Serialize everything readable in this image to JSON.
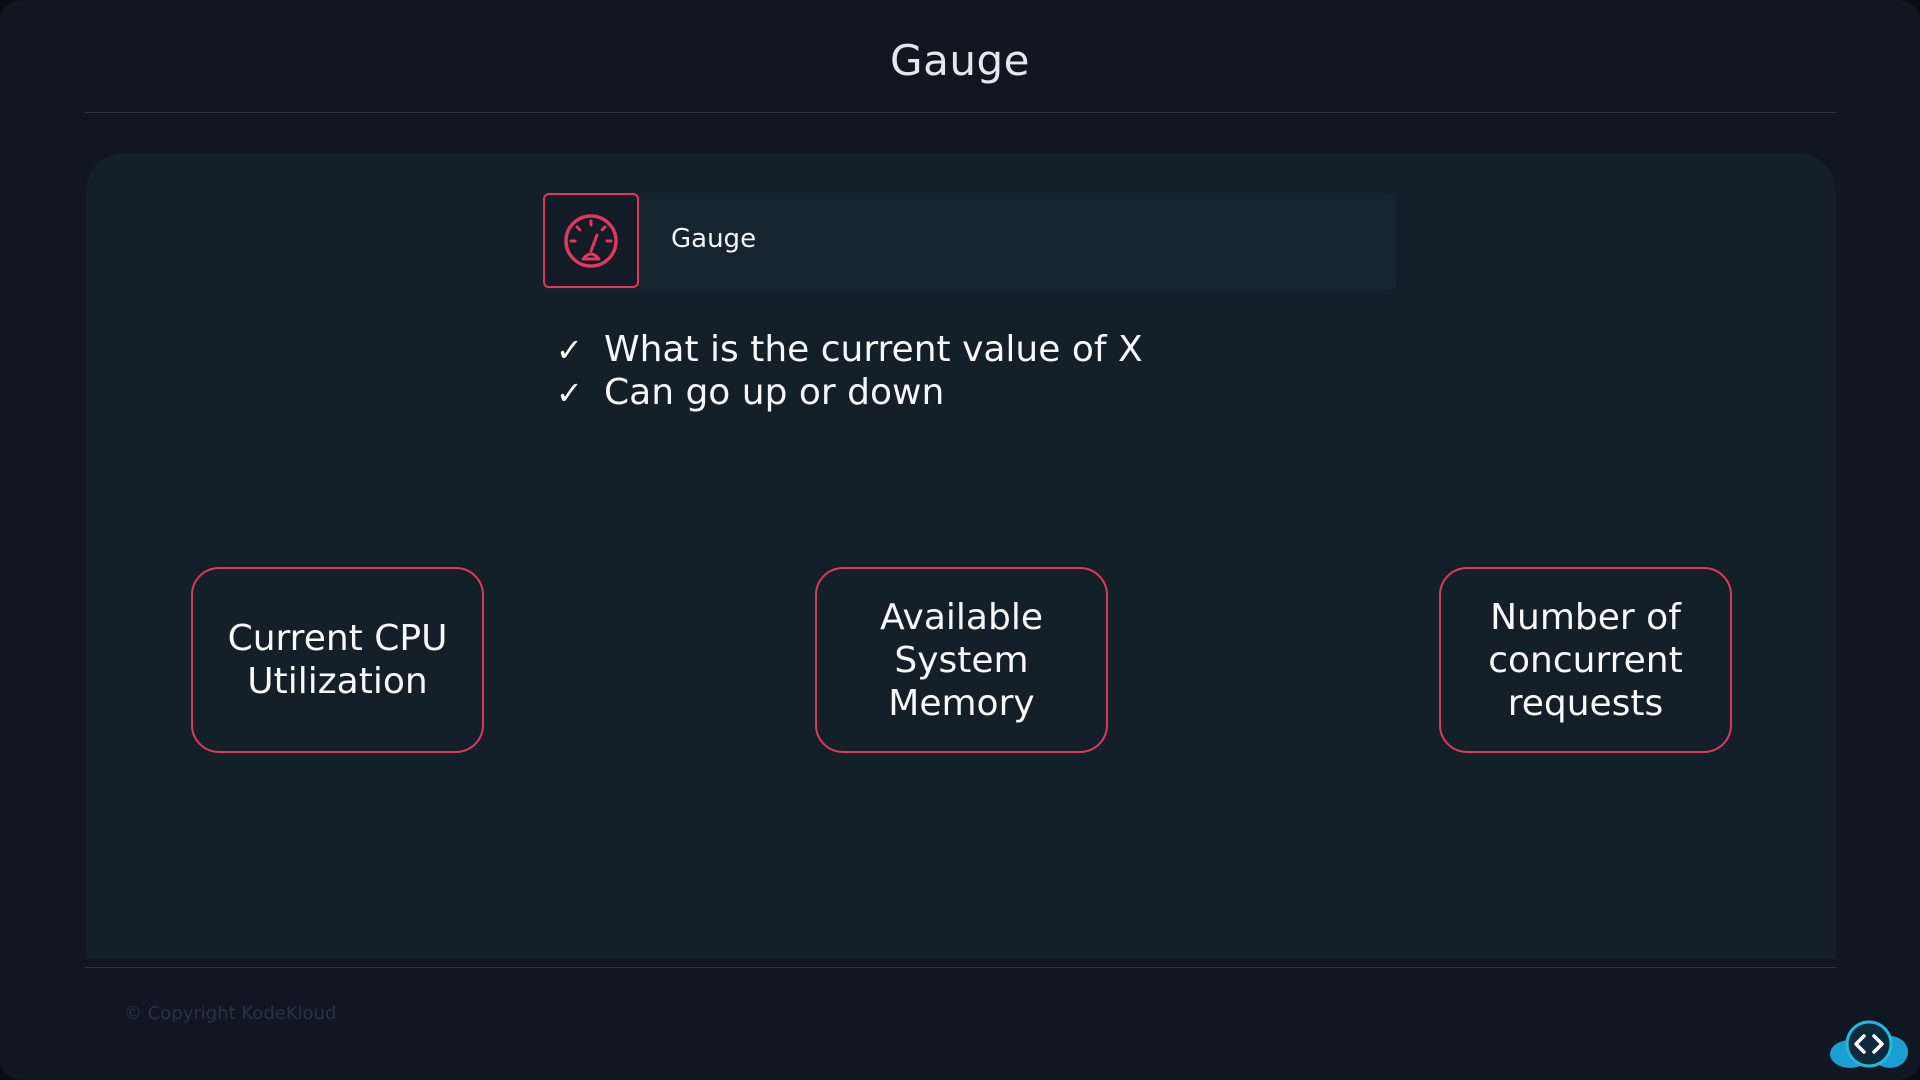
{
  "slide": {
    "title": "Gauge",
    "header": {
      "label": "Gauge",
      "icon": "gauge-icon"
    },
    "bullets": [
      "What is the current value of X",
      "Can go up or down"
    ],
    "check_symbol": "✓",
    "cards": [
      "Current CPU Utilization",
      "Available System Memory",
      "Number of concurrent requests"
    ],
    "copyright": "© Copyright KodeKloud"
  },
  "colors": {
    "accent": "#e0385d",
    "background": "#111722",
    "panel": "#131f29",
    "logo_cyan": "#20b8e0"
  }
}
